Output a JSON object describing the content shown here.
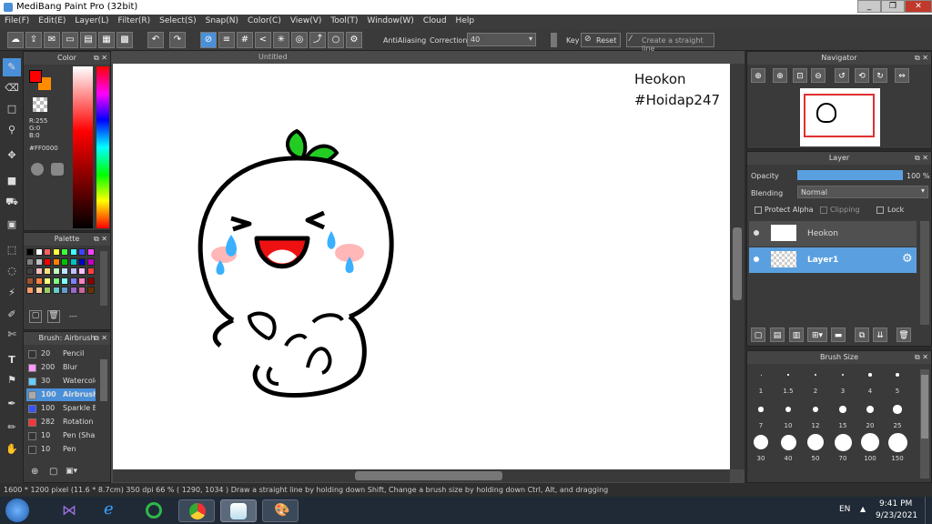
{
  "app": {
    "title": "MediBang Paint Pro (32bit)"
  },
  "menu": [
    "File(F)",
    "Edit(E)",
    "Layer(L)",
    "Filter(R)",
    "Select(S)",
    "Snap(N)",
    "Color(C)",
    "View(V)",
    "Tool(T)",
    "Window(W)",
    "Cloud",
    "Help"
  ],
  "toolbar": {
    "antialiasing": "AntiAliasing",
    "correction_label": "Correction",
    "correction_value": "40",
    "key_label": "Key",
    "reset_label": "Reset",
    "straight_line": "Create a straight line"
  },
  "color_panel": {
    "title": "Color",
    "r": "R:255",
    "g": "G:0",
    "b": "B:0",
    "hex": "#FF0000",
    "primary": "#ff0000",
    "secondary": "#ff8c00"
  },
  "palette_panel": {
    "title": "Palette",
    "dash": "---",
    "colors": [
      "#000000",
      "#ffffff",
      "#ff6060",
      "#ffff40",
      "#40ff40",
      "#40ffff",
      "#4040ff",
      "#ff40ff",
      "#808080",
      "#c0c0c0",
      "#ff0000",
      "#ff8000",
      "#00c000",
      "#00c0c0",
      "#0000c0",
      "#c000c0",
      "#404040",
      "#ffc0c0",
      "#ffe080",
      "#c0ffc0",
      "#c0e0ff",
      "#c0c0ff",
      "#ffc0ff",
      "#ff4040",
      "#a0522d",
      "#ff8040",
      "#ffff80",
      "#80ff80",
      "#80ffff",
      "#8080ff",
      "#ff80c0",
      "#8b0000",
      "#ff9966",
      "#ffcc99",
      "#99cc66",
      "#66cccc",
      "#6699cc",
      "#9966cc",
      "#cc6699",
      "#663300"
    ]
  },
  "brush_panel": {
    "title": "Brush: Airbrush",
    "items": [
      {
        "size": "20",
        "name": "Pencil",
        "color": "#333333"
      },
      {
        "size": "200",
        "name": "Blur",
        "color": "#ff99ff"
      },
      {
        "size": "30",
        "name": "Watercolor",
        "color": "#66ccff"
      },
      {
        "size": "100",
        "name": "Airbrush",
        "color": "#aaaaaa"
      },
      {
        "size": "100",
        "name": "Sparkle Brush",
        "color": "#3355ff"
      },
      {
        "size": "282",
        "name": "Rotation",
        "color": "#ff3333"
      },
      {
        "size": "10",
        "name": "Pen (Shape)",
        "color": "#333333"
      },
      {
        "size": "10",
        "name": "Pen",
        "color": "#333333"
      }
    ]
  },
  "document": {
    "tab": "Untitled",
    "watermark1": "Heokon",
    "watermark2": "#Hoidap247"
  },
  "navigator": {
    "title": "Navigator"
  },
  "layer_panel": {
    "title": "Layer",
    "opacity_label": "Opacity",
    "opacity_value": "100 %",
    "opacity_fraction": 1.0,
    "blending_label": "Blending",
    "blending_value": "Normal",
    "protect_alpha": "Protect Alpha",
    "clipping": "Clipping",
    "lock": "Lock",
    "layers": [
      {
        "name": "Heokon"
      },
      {
        "name": "Layer1"
      }
    ]
  },
  "brushsize_panel": {
    "title": "Brush Size",
    "sizes": [
      "1",
      "1.5",
      "2",
      "3",
      "4",
      "5",
      "7",
      "10",
      "12",
      "15",
      "20",
      "25",
      "30",
      "40",
      "50",
      "70",
      "100",
      "150"
    ]
  },
  "status": {
    "text": "1600 * 1200 pixel  (11.6 * 8.7cm)  350 dpi  66 %  ( 1290, 1034 )  Draw a straight line by holding down Shift, Change a brush size by holding down Ctrl, Alt, and dragging"
  },
  "taskbar": {
    "lang": "EN",
    "time": "9:41 PM",
    "date": "9/23/2021"
  }
}
